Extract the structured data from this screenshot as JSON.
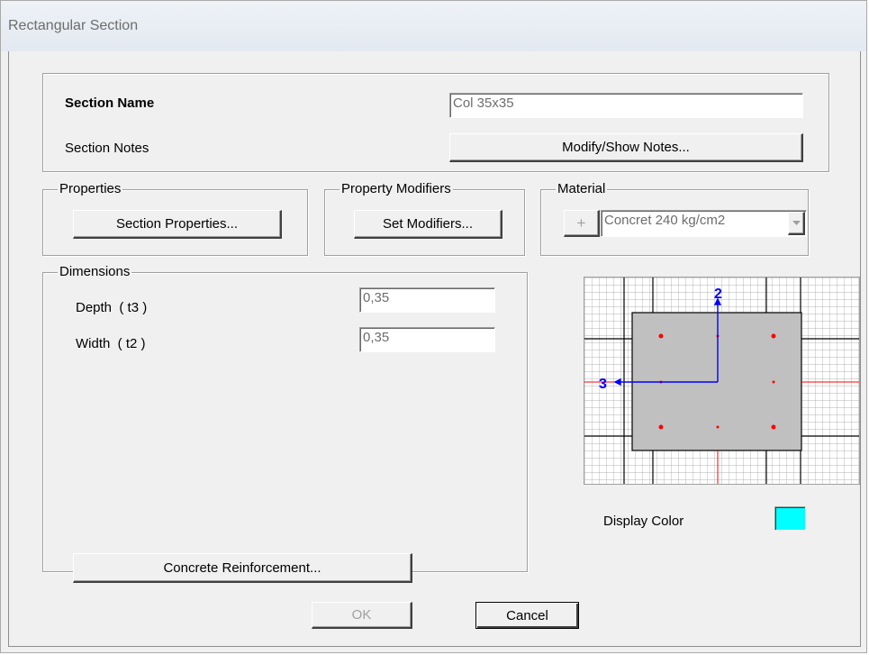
{
  "window": {
    "title": "Rectangular Section"
  },
  "section": {
    "name_label": "Section Name",
    "name_value": "Col 35x35",
    "notes_label": "Section Notes",
    "notes_button": "Modify/Show Notes..."
  },
  "properties": {
    "legend": "Properties",
    "button": "Section Properties..."
  },
  "modifiers": {
    "legend": "Property Modifiers",
    "button": "Set Modifiers..."
  },
  "material": {
    "legend": "Material",
    "add_symbol": "+",
    "selected": "Concret 240 kg/cm2"
  },
  "dimensions": {
    "legend": "Dimensions",
    "depth_label": "Depth  ( t3 )",
    "depth_value": "0,35",
    "width_label": "Width  ( t2 )",
    "width_value": "0,35"
  },
  "preview": {
    "axis2_label": "2",
    "axis3_label": "3",
    "colors": {
      "section_fill": "#c0c0c0",
      "rebar": "#ff0000",
      "axis": "#0000ff",
      "grid": "#9a9a9a"
    }
  },
  "display_color": {
    "label": "Display Color",
    "value": "#00ffff"
  },
  "buttons": {
    "reinforcement": "Concrete Reinforcement...",
    "ok": "OK",
    "cancel": "Cancel"
  }
}
